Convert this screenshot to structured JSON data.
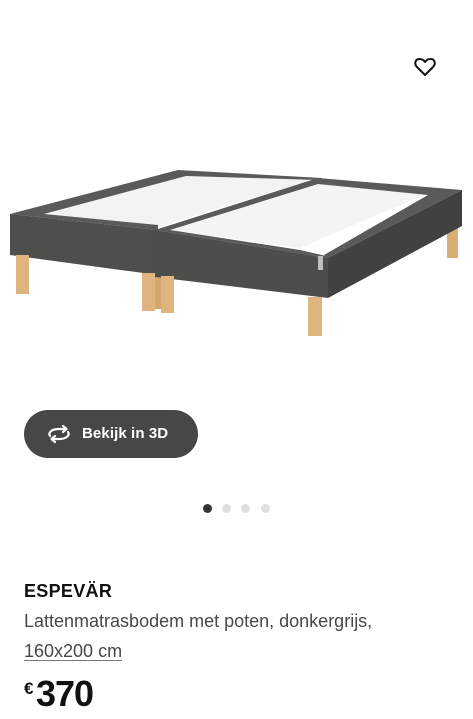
{
  "product": {
    "name": "ESPEVÄR",
    "description": "Lattenmatrasbodem met poten, donkergrijs,",
    "size": "160x200 cm",
    "price": {
      "currency": "€",
      "amount": "370"
    }
  },
  "gallery": {
    "view_3d_label": "Bekijk in 3D",
    "total_images": 4,
    "active_index": 0
  },
  "icons": {
    "favorite": "heart-outline-icon",
    "view_3d": "rotate-3d-icon"
  },
  "colors": {
    "button_background": "#474747",
    "active_dot": "#333333",
    "inactive_dot": "#e0e0e0",
    "frame": "#4e514e",
    "legs": "#deb57e"
  }
}
